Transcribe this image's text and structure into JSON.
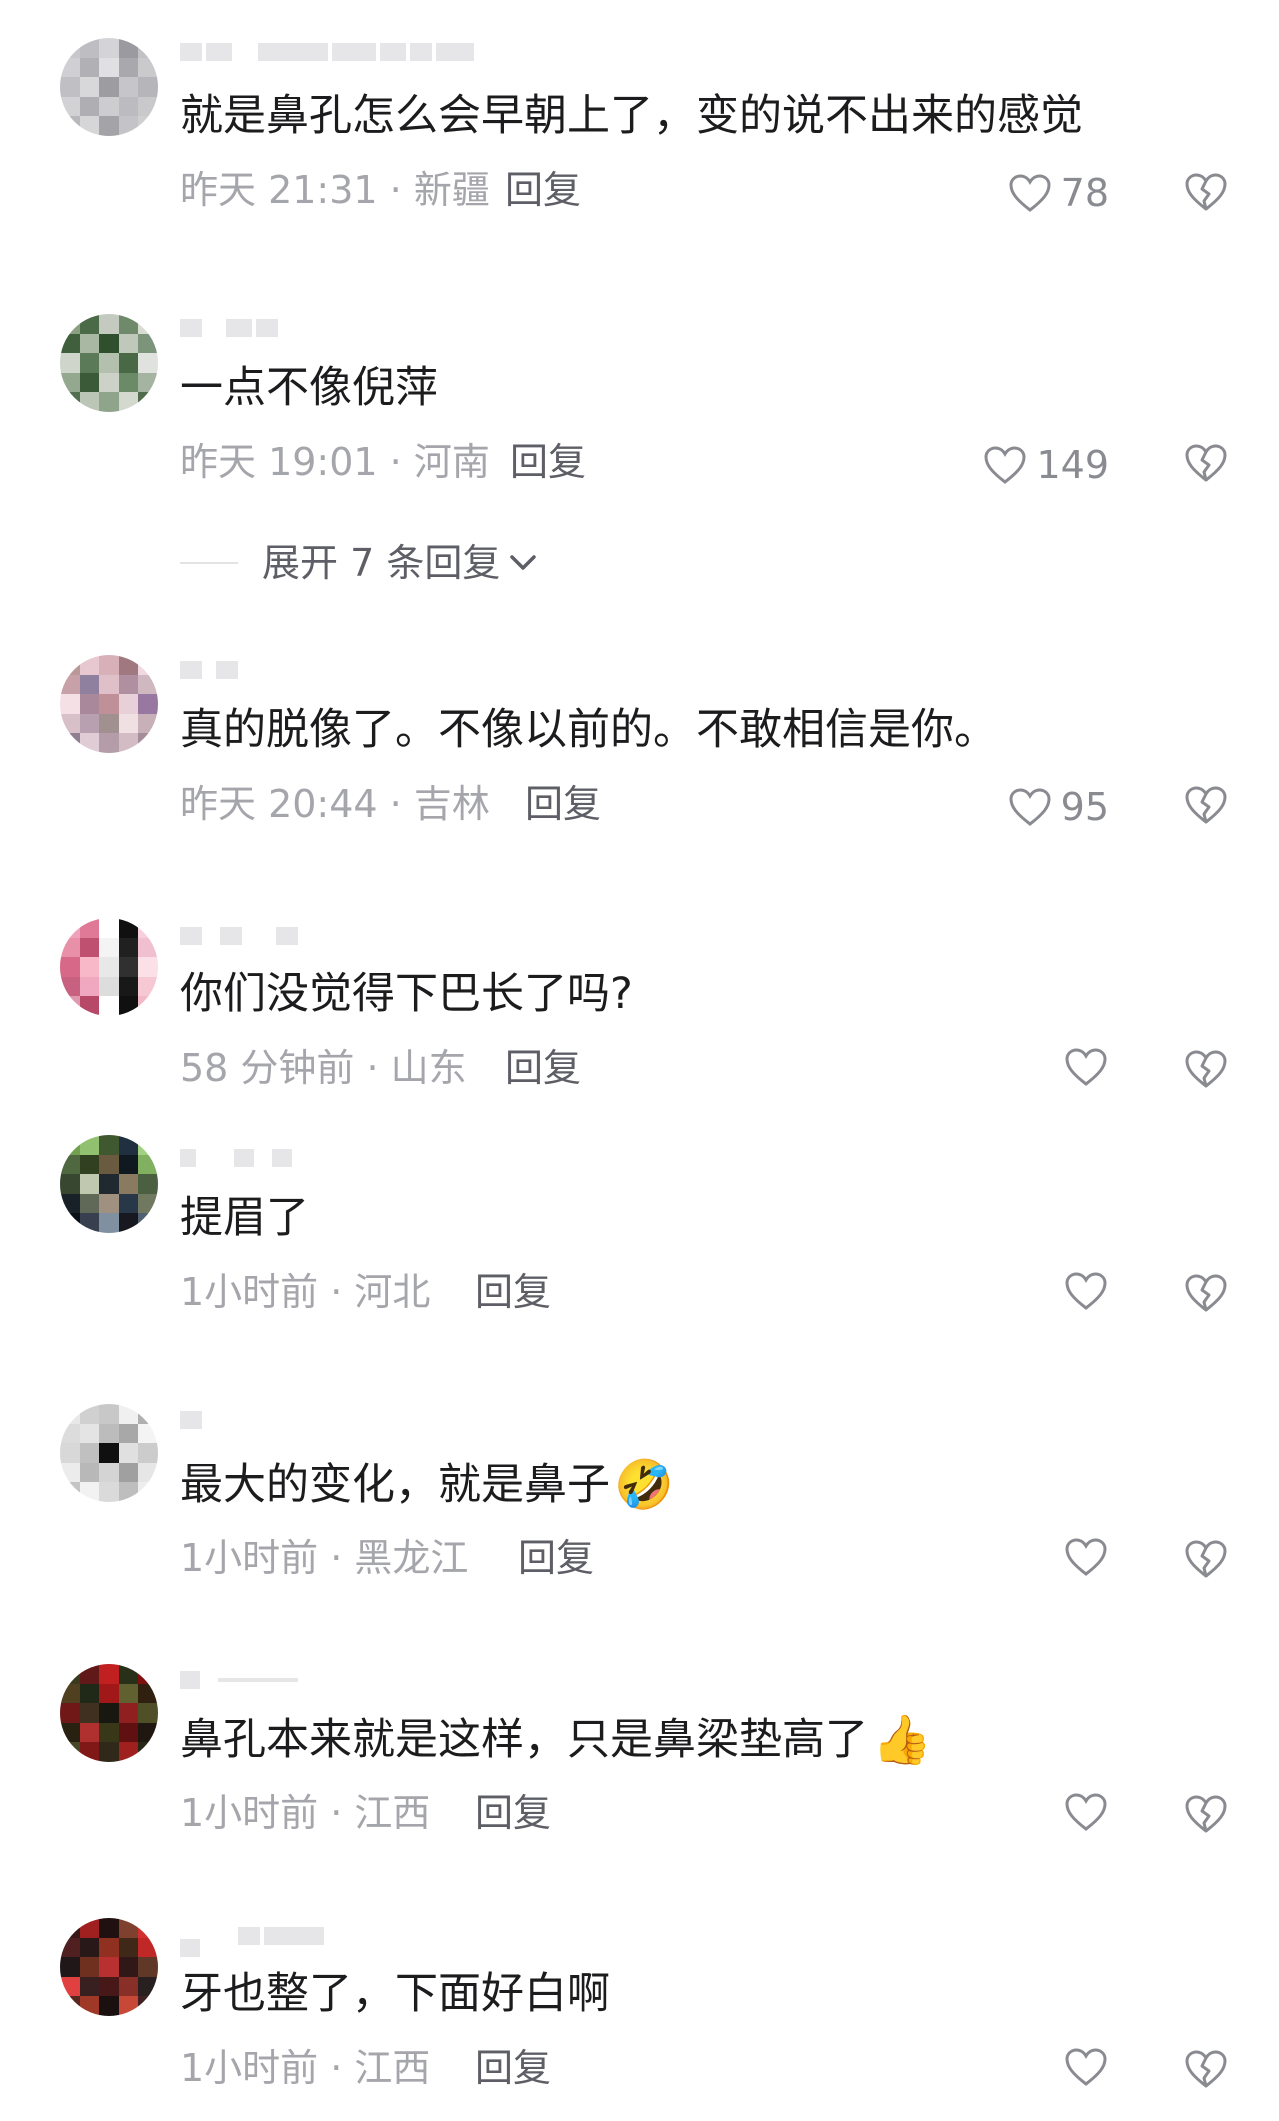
{
  "comments": [
    {
      "text": "就是鼻孔怎么会早朝上了，变的说不出来的感觉",
      "time": "昨天 21:31 · 新疆",
      "reply": "回复",
      "likes": "78",
      "emoji": "",
      "avatar_colors": [
        "#c8c8cc",
        "#bdbdc2",
        "#d4d4d8",
        "#9a9aa0",
        "#c2c2c6",
        "#d0d0d4",
        "#b0b0b5",
        "#e0e0e3",
        "#a8a8ad",
        "#cacacd",
        "#bfbfc4",
        "#d8d8db",
        "#9c9ca1",
        "#c6c6ca",
        "#b5b5ba",
        "#d2d2d5",
        "#aeaeb3",
        "#cdcdd0",
        "#bcbcc0",
        "#c9c9cc",
        "#b8b8bc",
        "#d6d6d9",
        "#a3a3a8",
        "#c4c4c8",
        "#cfcfd2"
      ]
    },
    {
      "text": "一点不像倪萍",
      "time": "昨天 19:01 · 河南",
      "reply": "回复",
      "likes": "149",
      "emoji": "",
      "avatar_colors": [
        "#8aa080",
        "#4a6a48",
        "#c5cac0",
        "#6e8a6a",
        "#d8dcd3",
        "#3f5f3d",
        "#a8b8a2",
        "#2f4f2d",
        "#c0c8bc",
        "#7b947a",
        "#d0d5cb",
        "#5a7a58",
        "#b2c0ad",
        "#486846",
        "#e0e3dd",
        "#94a890",
        "#3a5a38",
        "#ccd2c8",
        "#6a8a68",
        "#a4b4a0",
        "#52704f",
        "#bcc6b7",
        "#8fa58b",
        "#d4d9cf",
        "#4f6d4c"
      ]
    },
    {
      "text": "真的脱像了。不像以前的。不敢相信是你。",
      "time": "昨天 20:44 · 吉林",
      "reply": "回复",
      "likes": "95",
      "emoji": "",
      "avatar_colors": [
        "#b89898",
        "#e8c8d0",
        "#d8b0b8",
        "#a07880",
        "#f0d8e0",
        "#c8a0a8",
        "#9080a0",
        "#e0c0c8",
        "#b090a0",
        "#d0b8c0",
        "#f5e0e6",
        "#a8889a",
        "#c09098",
        "#e8d0d8",
        "#9878a0",
        "#d8c0c8",
        "#b8a0b0",
        "#a09090",
        "#f0e0e4",
        "#c8b0b8",
        "#8f7f90",
        "#e0ccd4",
        "#b49ca8",
        "#d4bcc4",
        "#a48c98"
      ]
    },
    {
      "text": "你们没觉得下巴长了吗?",
      "time": "58 分钟前 · 山东",
      "reply": "回复",
      "likes": "",
      "emoji": "",
      "avatar_colors": [
        "#f0a0b8",
        "#e07898",
        "#ffffff",
        "#101010",
        "#f8d0dc",
        "#e890a8",
        "#c05070",
        "#f4f4f4",
        "#202020",
        "#f0c0d0",
        "#d86888",
        "#f8b8c8",
        "#e8e8e8",
        "#303030",
        "#fce0e8",
        "#c86080",
        "#f0a8c0",
        "#dddddd",
        "#181818",
        "#f6c8d4",
        "#e098b0",
        "#b84868",
        "#ffffff",
        "#101010",
        "#f2b8c8"
      ]
    },
    {
      "text": "提眉了",
      "time": "1小时前 · 河北",
      "reply": "回复",
      "likes": "",
      "emoji": "",
      "avatar_colors": [
        "#70a050",
        "#90c070",
        "#405830",
        "#203040",
        "#a0d080",
        "#506840",
        "#304020",
        "#6a5a40",
        "#101820",
        "#80b060",
        "#384830",
        "#c0c8b0",
        "#202830",
        "#8a7a60",
        "#4a6040",
        "#182028",
        "#606858",
        "#a09080",
        "#283848",
        "#707860",
        "#0a1018",
        "#384050",
        "#8090a0",
        "#181820",
        "#506070"
      ]
    },
    {
      "text": "最大的变化，就是鼻子",
      "time": "1小时前 · 黑龙江",
      "reply": "回复",
      "likes": "",
      "emoji": "🤣",
      "avatar_colors": [
        "#e8e8e8",
        "#d0d0d0",
        "#c8c8c8",
        "#f0f0f0",
        "#b0b0b0",
        "#dcdcdc",
        "#e4e4e4",
        "#bcbcbc",
        "#a8a8a8",
        "#f4f4f4",
        "#d8d8d8",
        "#c0c0c0",
        "#101010",
        "#e0e0e0",
        "#cccccc",
        "#ececec",
        "#b8b8b8",
        "#d4d4d4",
        "#a0a0a0",
        "#e6e6e6",
        "#c4c4c4",
        "#f2f2f2",
        "#dadada",
        "#bebebe",
        "#eeeeee"
      ]
    },
    {
      "text": "鼻孔本来就是这样，只是鼻梁垫高了",
      "time": "1小时前 · 江西",
      "reply": "回复",
      "likes": "",
      "emoji": "👍",
      "avatar_colors": [
        "#3a3a20",
        "#601818",
        "#c02020",
        "#283018",
        "#801010",
        "#504020",
        "#202818",
        "#a01818",
        "#606030",
        "#302010",
        "#701818",
        "#403020",
        "#181810",
        "#902020",
        "#505028",
        "#282010",
        "#b03030",
        "#383818",
        "#601010",
        "#201810",
        "#484828",
        "#801818",
        "#302818",
        "#a02020",
        "#282818"
      ]
    },
    {
      "text": "牙也整了，下面好白啊",
      "time": "1小时前 · 江西",
      "reply": "回复",
      "likes": "",
      "emoji": "",
      "avatar_colors": [
        "#3a1818",
        "#a02020",
        "#201010",
        "#804030",
        "#d03030",
        "#502020",
        "#281818",
        "#903020",
        "#402818",
        "#c02828",
        "#201818",
        "#703020",
        "#b83030",
        "#301818",
        "#603828",
        "#e04040",
        "#382020",
        "#481818",
        "#883028",
        "#282020",
        "#582820",
        "#a03828",
        "#1a1010",
        "#c84838",
        "#402020"
      ]
    }
  ],
  "expand_replies": "展开 7 条回复"
}
